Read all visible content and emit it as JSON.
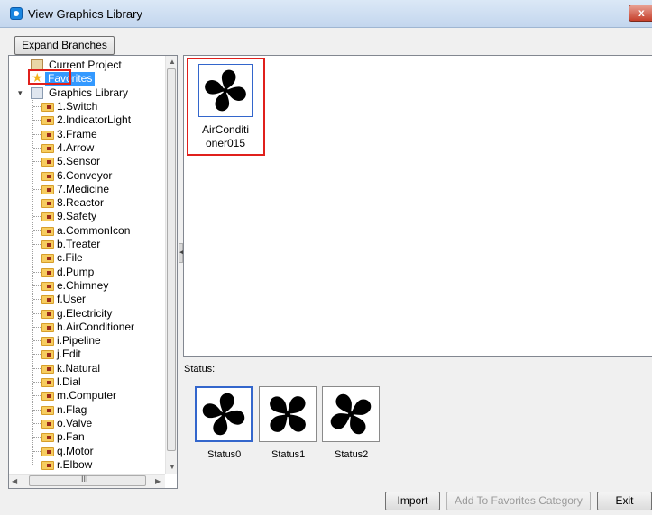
{
  "window": {
    "title": "View Graphics Library",
    "close_label": "x"
  },
  "toolbar": {
    "expand_branches_label": "Expand Branches"
  },
  "tree": {
    "current_project": "Current Project",
    "favorites": "Favorites",
    "graphics_library": "Graphics Library",
    "items": [
      "1.Switch",
      "2.IndicatorLight",
      "3.Frame",
      "4.Arrow",
      "5.Sensor",
      "6.Conveyor",
      "7.Medicine",
      "8.Reactor",
      "9.Safety",
      "a.CommonIcon",
      "b.Treater",
      "c.File",
      "d.Pump",
      "e.Chimney",
      "f.User",
      "g.Electricity",
      "h.AirConditioner",
      "i.Pipeline",
      "j.Edit",
      "k.Natural",
      "l.Dial",
      "m.Computer",
      "n.Flag",
      "o.Valve",
      "p.Fan",
      "q.Motor",
      "r.Elbow"
    ],
    "hscroll_grip": "III"
  },
  "gallery": {
    "item_label": "AirConditi oner015"
  },
  "status": {
    "label": "Status:",
    "items": [
      "Status0",
      "Status1",
      "Status2"
    ]
  },
  "footer": {
    "import_label": "Import",
    "add_favorites_label": "Add To Favorites Category",
    "exit_label": "Exit"
  },
  "colors": {
    "highlight": "#e0201c",
    "selection": "#3399ff",
    "fan": "#000000"
  }
}
